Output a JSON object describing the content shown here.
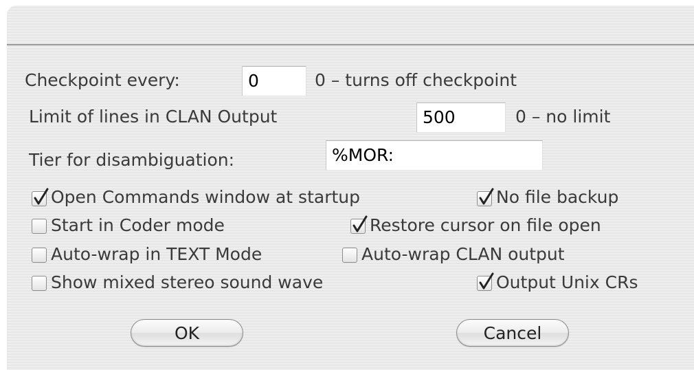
{
  "dialog": {
    "checkpoint": {
      "label": "Checkpoint every:",
      "value": "0",
      "hint": "0 – turns off checkpoint"
    },
    "limit_lines": {
      "label": "Limit of lines in CLAN Output",
      "value": "500",
      "hint": "0 – no limit"
    },
    "tier": {
      "label": "Tier for disambiguation:",
      "value": "%MOR:"
    },
    "options": [
      {
        "label": "Open Commands window at startup",
        "checked": true
      },
      {
        "label": "No  file backup",
        "checked": true
      },
      {
        "label": "Start in Coder mode",
        "checked": false
      },
      {
        "label": "Restore cursor on file open",
        "checked": true
      },
      {
        "label": "Auto-wrap in TEXT Mode",
        "checked": false
      },
      {
        "label": "Auto-wrap CLAN output",
        "checked": false
      },
      {
        "label": "Show mixed stereo sound wave",
        "checked": false
      },
      {
        "label": "Output Unix CRs",
        "checked": true
      }
    ],
    "buttons": {
      "ok": "OK",
      "cancel": "Cancel"
    }
  }
}
